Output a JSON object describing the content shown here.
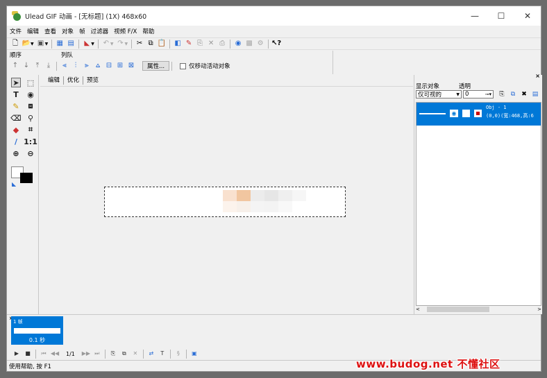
{
  "window": {
    "title": "Ulead GIF 动画 - [无标题] (1X) 468x60",
    "controls": {
      "minimize": "—",
      "maximize": "☐",
      "close": "✕"
    }
  },
  "menu": [
    "文件",
    "编辑",
    "查看",
    "对象",
    "帧",
    "过滤器",
    "视频 F/X",
    "帮助"
  ],
  "toolbar2": {
    "order_label": "顺序",
    "align_label": "列队",
    "properties_button": "属性...",
    "move_active_only_label": "仅移动活动对象"
  },
  "editor": {
    "tabs": [
      "编辑",
      "优化",
      "预览"
    ],
    "active_tab": 0
  },
  "objects_panel": {
    "display_label": "显示对象",
    "transparency_label": "透明",
    "display_value": "仅可视的",
    "transparency_value": "0",
    "object": {
      "name": "Obj - 1",
      "info": "(0,0)(宽:468,高:6"
    }
  },
  "frame_panel": {
    "frame_label": "1 帧",
    "delay": "0.1 秒",
    "counter": "1/1"
  },
  "status": "使用帮助, 按 F1",
  "watermark": "www.budog.net 不懂社区",
  "colors": {
    "selection": "#0078d7",
    "foreground": "#ffffff",
    "background": "#000000"
  }
}
